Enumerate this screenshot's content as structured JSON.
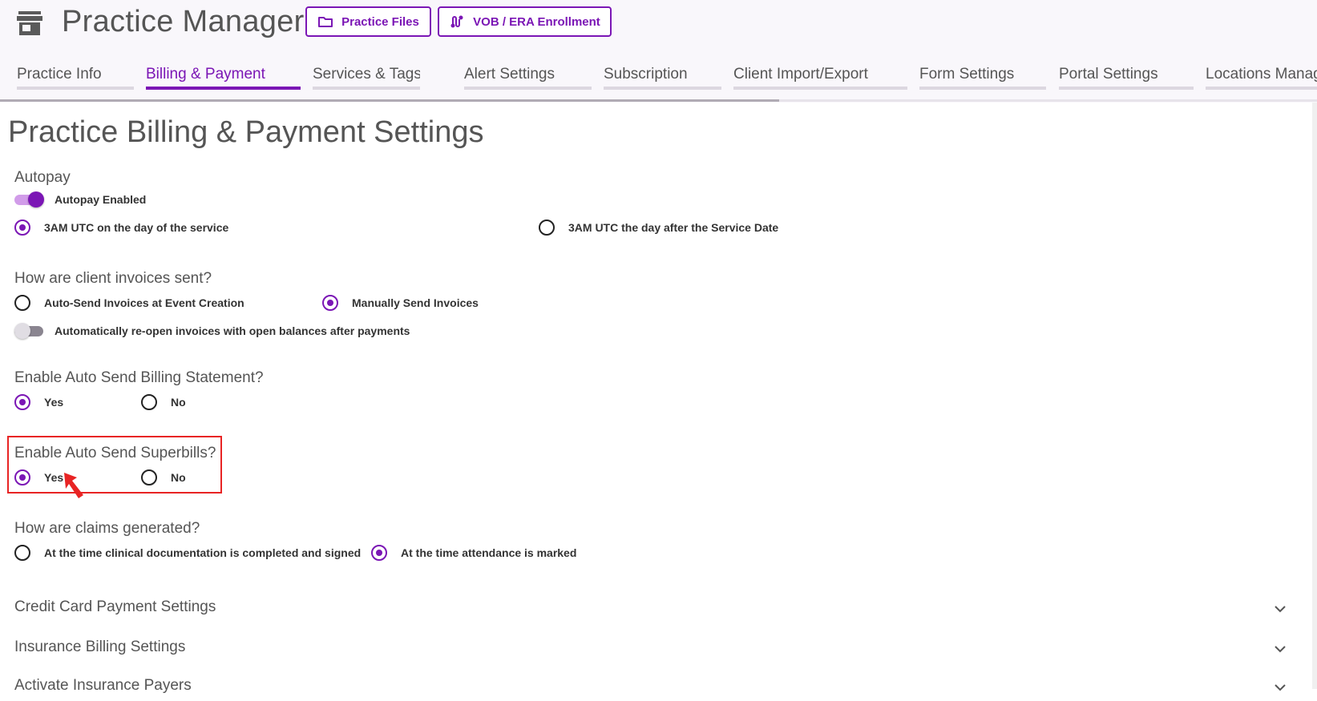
{
  "header": {
    "app_title": "Practice Manager",
    "icon": "store-icon",
    "buttons": [
      {
        "label": "Practice Files",
        "icon": "folder-icon"
      },
      {
        "label": "VOB / ERA Enrollment",
        "icon": "route-icon"
      }
    ]
  },
  "tabs": [
    {
      "label": "Practice Info",
      "active": false
    },
    {
      "label": "Billing & Payment",
      "active": true
    },
    {
      "label": "Services & Tags",
      "active": false
    },
    {
      "label": "Alert Settings",
      "active": false
    },
    {
      "label": "Subscription",
      "active": false
    },
    {
      "label": "Client Import/Export",
      "active": false
    },
    {
      "label": "Form Settings",
      "active": false
    },
    {
      "label": "Portal Settings",
      "active": false
    },
    {
      "label": "Locations Manag",
      "active": false
    }
  ],
  "page_title": "Practice Billing & Payment Settings",
  "autopay": {
    "label": "Autopay",
    "toggle_label": "Autopay Enabled",
    "toggle_on": true,
    "options": [
      {
        "label": "3AM UTC on the day of the service",
        "checked": true
      },
      {
        "label": "3AM UTC the day after the Service Date",
        "checked": false
      }
    ]
  },
  "invoices": {
    "label": "How are client invoices sent?",
    "options": [
      {
        "label": "Auto-Send Invoices at Event Creation",
        "checked": false
      },
      {
        "label": "Manually Send Invoices",
        "checked": true
      }
    ],
    "toggle_label": "Automatically re-open invoices with open balances after payments",
    "toggle_on": false
  },
  "billing_statement": {
    "label": "Enable Auto Send Billing Statement?",
    "options": [
      {
        "label": "Yes",
        "checked": true
      },
      {
        "label": "No",
        "checked": false
      }
    ]
  },
  "superbills": {
    "label": "Enable Auto Send Superbills?",
    "options": [
      {
        "label": "Yes",
        "checked": true
      },
      {
        "label": "No",
        "checked": false
      }
    ]
  },
  "claims": {
    "label": "How are claims generated?",
    "options": [
      {
        "label": "At the time clinical documentation is completed and signed",
        "checked": false
      },
      {
        "label": "At the time attendance is marked",
        "checked": true
      }
    ]
  },
  "accordions": [
    {
      "title": "Credit Card Payment Settings",
      "icon": "chevron-down-icon"
    },
    {
      "title": "Insurance Billing Settings",
      "icon": "chevron-down-icon"
    },
    {
      "title": "Activate Insurance Payers",
      "icon": "chevron-down-icon"
    }
  ],
  "colors": {
    "accent": "#7b16b5",
    "highlight": "#e82424",
    "header_bg": "#f9f7fb"
  }
}
